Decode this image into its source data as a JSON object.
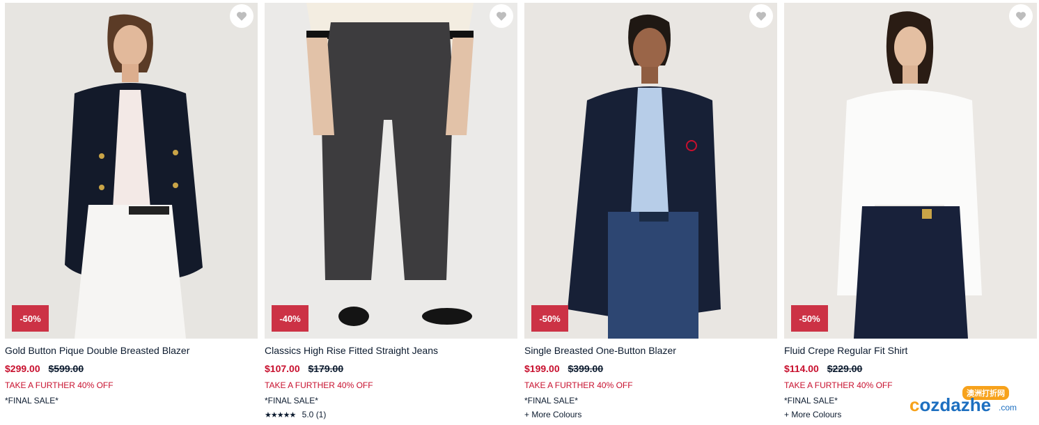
{
  "products": [
    {
      "name": "Gold Button Pique Double Breasted Blazer",
      "price": "$299.00",
      "was_price": "$599.00",
      "discount_badge": "-50%",
      "promo": "TAKE A FURTHER 40% OFF",
      "final_sale": "*FINAL SALE*",
      "extra": ""
    },
    {
      "name": "Classics High Rise Fitted Straight Jeans",
      "price": "$107.00",
      "was_price": "$179.00",
      "discount_badge": "-40%",
      "promo": "TAKE A FURTHER 40% OFF",
      "final_sale": "*FINAL SALE*",
      "rating_stars": "★★★★★",
      "rating_value": "5.0",
      "rating_count": "(1)"
    },
    {
      "name": "Single Breasted One-Button Blazer",
      "price": "$199.00",
      "was_price": "$399.00",
      "discount_badge": "-50%",
      "promo": "TAKE A FURTHER 40% OFF",
      "final_sale": "*FINAL SALE*",
      "extra": "+ More Colours"
    },
    {
      "name": "Fluid Crepe Regular Fit Shirt",
      "price": "$114.00",
      "was_price": "$229.00",
      "discount_badge": "-50%",
      "promo": "TAKE A FURTHER 40% OFF",
      "final_sale": "*FINAL SALE*",
      "extra": "+ More Colours"
    }
  ],
  "icons": {
    "wishlist": "heart-icon",
    "rating": "star-icon"
  },
  "colors": {
    "sale_red": "#c8102e",
    "badge_red": "#cc3245",
    "text_navy": "#0b1a2e"
  },
  "watermark": {
    "top": "澳洲打折网",
    "main_c": "c",
    "main_rest": "ozdazhe",
    "suffix": ".com"
  }
}
